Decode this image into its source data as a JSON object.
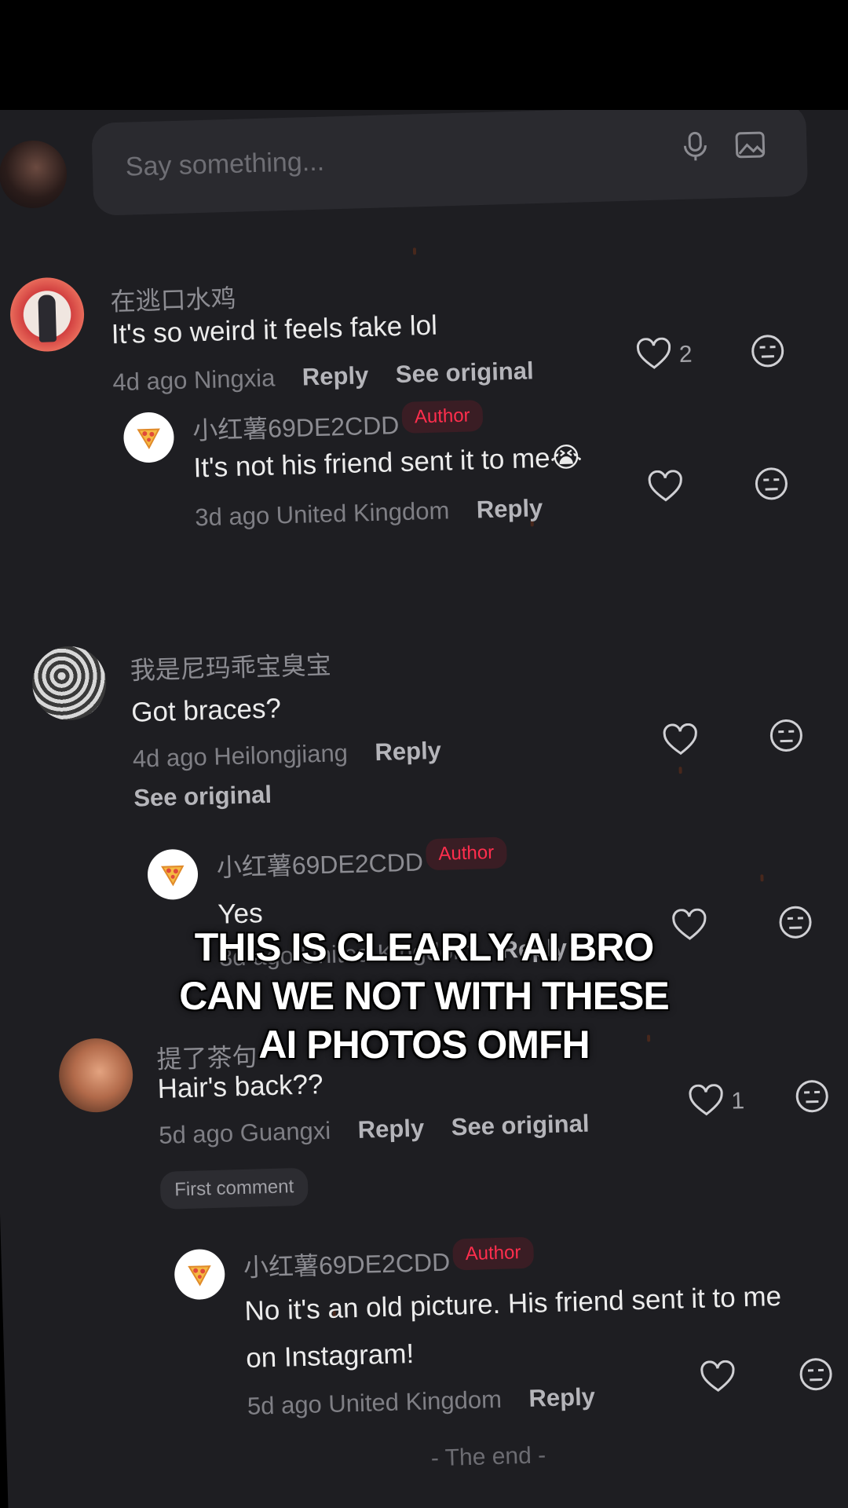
{
  "input": {
    "placeholder": "Say something..."
  },
  "comments": [
    {
      "username": "在逃口水鸡",
      "text": "It's so weird it feels fake lol",
      "time": "4d ago",
      "location": "Ningxia",
      "reply_label": "Reply",
      "see_original": "See original",
      "likes": "2",
      "reply": {
        "username": "小红薯69DE2CDD",
        "badge": "Author",
        "text": "It's not his friend sent it to me😭",
        "time": "3d ago",
        "location": "United Kingdom",
        "reply_label": "Reply"
      }
    },
    {
      "username": "我是尼玛乖宝臭宝",
      "text": "Got braces?",
      "time": "4d ago",
      "location": "Heilongjiang",
      "reply_label": "Reply",
      "see_original": "See original",
      "reply": {
        "username": "小红薯69DE2CDD",
        "badge": "Author",
        "text": "Yes",
        "time": "3d ago",
        "location": "United Kingdom",
        "reply_label": "Reply"
      }
    },
    {
      "username": "提了茶句",
      "text": "Hair's back??",
      "time": "5d ago",
      "location": "Guangxi",
      "reply_label": "Reply",
      "see_original": "See original",
      "likes": "1",
      "first_badge": "First comment",
      "reply": {
        "username": "小红薯69DE2CDD",
        "badge": "Author",
        "text_line1": "No it's an old picture. His friend sent it to me",
        "text_line2": "on Instagram!",
        "time": "5d ago",
        "location": "United Kingdom",
        "reply_label": "Reply"
      }
    }
  ],
  "end_label": "- The end -",
  "caption": {
    "line1": "THIS IS CLEARLY AI BRO",
    "line2": "CAN WE NOT WITH THESE",
    "line3": "AI PHOTOS OMFH"
  },
  "colors": {
    "background": "#1e1e22",
    "author_badge": "#ff2e4d",
    "caption": "#ffffff"
  }
}
